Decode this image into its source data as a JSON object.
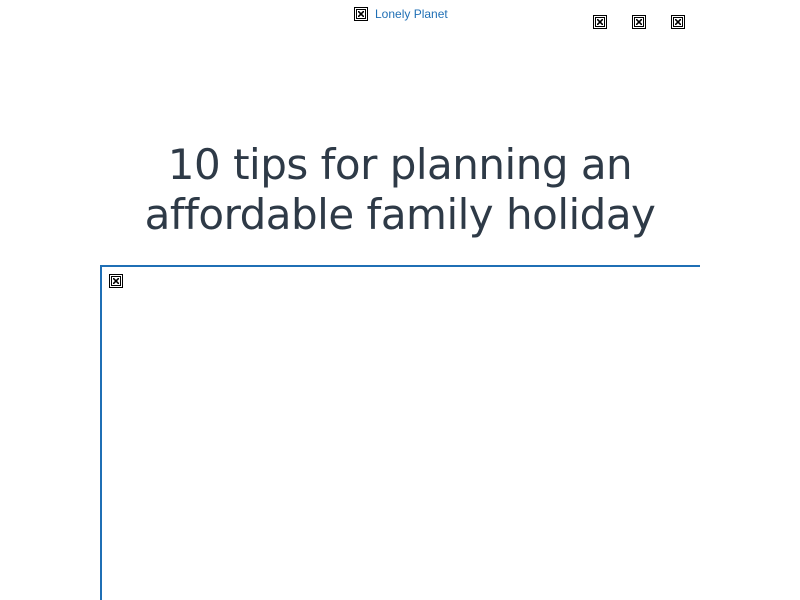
{
  "header": {
    "brand_name": "Lonely Planet",
    "logo_icon": "broken-image-icon",
    "action_icons": [
      "broken-image-icon",
      "broken-image-icon",
      "broken-image-icon"
    ]
  },
  "article": {
    "title": "10 tips for planning an affordable family holiday",
    "hero_image_icon": "broken-image-icon"
  },
  "colors": {
    "link": "#1f6fb5",
    "title": "#2e3a47",
    "frame_border": "#1f6fb5"
  }
}
